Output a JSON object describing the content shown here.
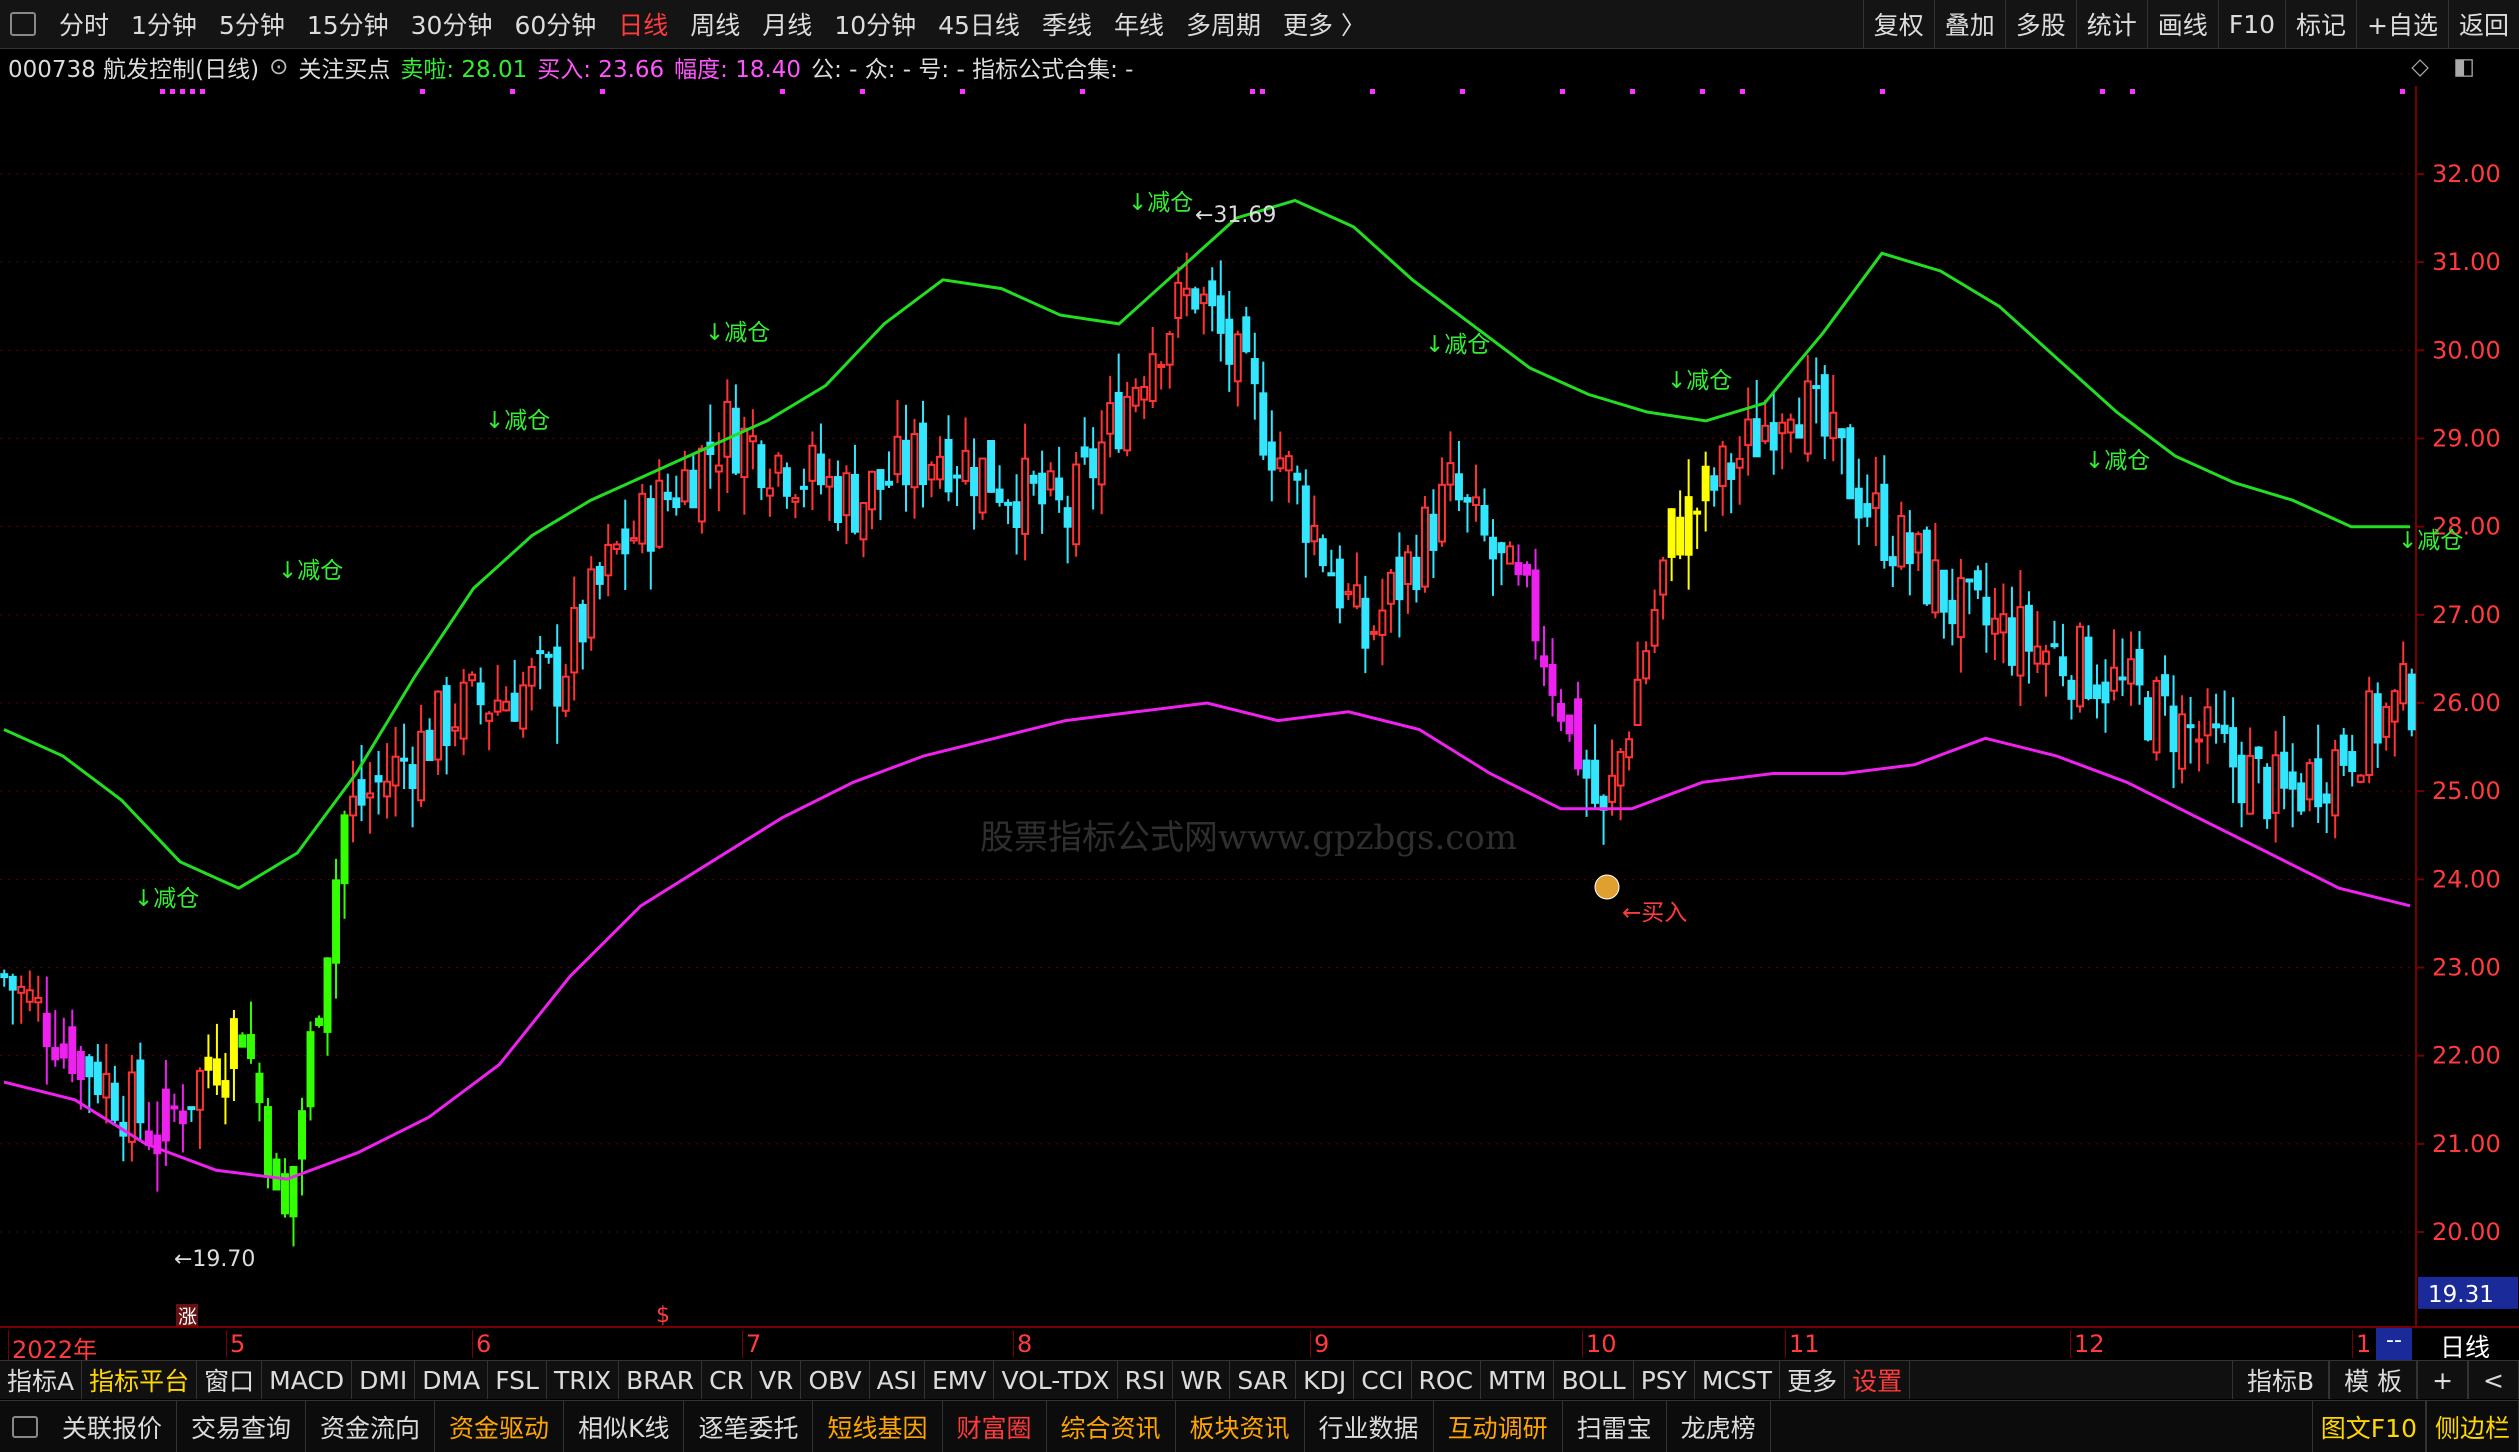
{
  "topbar": {
    "tabs": [
      "分时",
      "1分钟",
      "5分钟",
      "15分钟",
      "30分钟",
      "60分钟",
      "日线",
      "周线",
      "月线",
      "10分钟",
      "45日线",
      "季线",
      "年线",
      "多周期",
      "更多 〉"
    ],
    "active_tab": "日线",
    "right_buttons": [
      "复权",
      "叠加",
      "多股",
      "统计",
      "画线",
      "F10",
      "标记",
      "+自选",
      "返回"
    ]
  },
  "info": {
    "stock_title": "000738 航发控制(日线)",
    "indicator_name": "关注买点",
    "sell": "卖啦: 28.01",
    "buy": "买入: 23.66",
    "range": "幅度: 18.40",
    "extra": "公: -  众: -  号: -  指标公式合集: -"
  },
  "colors": {
    "up": "#ff3333",
    "down": "#33e6ff",
    "upper": "#22dd22",
    "lower": "#ee22ee",
    "yellow": "#ffff00",
    "green_bar": "#33ff00",
    "label_green": "#33ee33",
    "axis_red": "#ff3b3b"
  },
  "yaxis": {
    "ticks": [
      "32.00",
      "31.00",
      "30.00",
      "29.00",
      "28.00",
      "27.00",
      "26.00",
      "25.00",
      "24.00",
      "23.00",
      "22.00",
      "21.00",
      "20.00"
    ],
    "current_price": "19.31"
  },
  "xaxis": {
    "labels": [
      "2022年",
      "5",
      "6",
      "7",
      "8",
      "9",
      "10",
      "11",
      "12",
      "1"
    ],
    "period_label": "日线",
    "end_marker": "--"
  },
  "annotations": {
    "sell_label": "↓减仓",
    "buy_label": "←买入",
    "high_label": "←31.69",
    "low_label": "←19.70",
    "zhang_mark": "涨",
    "dollar_mark": "$",
    "watermark": "股票指标公式网www.gpzbgs.com"
  },
  "chart_data": {
    "type": "candlestick",
    "series_names": [],
    "price_range": [
      19.5,
      32.7
    ],
    "high": 31.69,
    "low": 19.7,
    "current": 19.31,
    "upper_band": [
      25.7,
      25.4,
      24.9,
      24.2,
      23.9,
      24.3,
      25.2,
      26.3,
      27.3,
      27.9,
      28.3,
      28.6,
      28.9,
      29.2,
      29.6,
      30.3,
      30.8,
      30.7,
      30.4,
      30.3,
      30.9,
      31.5,
      31.7,
      31.4,
      30.8,
      30.3,
      29.8,
      29.5,
      29.3,
      29.2,
      29.4,
      30.2,
      31.1,
      30.9,
      30.5,
      29.9,
      29.3,
      28.8,
      28.5,
      28.3,
      28.0,
      28.0
    ],
    "lower_band": [
      21.7,
      21.5,
      21.0,
      20.7,
      20.6,
      20.9,
      21.3,
      21.9,
      22.9,
      23.7,
      24.2,
      24.7,
      25.1,
      25.4,
      25.6,
      25.8,
      25.9,
      26.0,
      25.8,
      25.9,
      25.7,
      25.2,
      24.8,
      24.8,
      25.1,
      25.2,
      25.2,
      25.3,
      25.6,
      25.4,
      25.1,
      24.7,
      24.3,
      23.9,
      23.7
    ],
    "sell_signals": 8,
    "buy_signals": 1
  },
  "indbar": {
    "items": [
      "指标A",
      "指标平台",
      "窗口",
      "MACD",
      "DMI",
      "DMA",
      "FSL",
      "TRIX",
      "BRAR",
      "CR",
      "VR",
      "OBV",
      "ASI",
      "EMV",
      "VOL-TDX",
      "RSI",
      "WR",
      "SAR",
      "KDJ",
      "CCI",
      "ROC",
      "MTM",
      "BOLL",
      "PSY",
      "MCST",
      "更多",
      "设置"
    ],
    "highlight": "指标平台",
    "settings": "设置",
    "right_items": [
      "指标B",
      "模 板",
      "+",
      "<"
    ]
  },
  "funcbar": {
    "items": [
      {
        "label": "关联报价",
        "color": "#dcdcdc"
      },
      {
        "label": "交易查询",
        "color": "#dcdcdc"
      },
      {
        "label": "资金流向",
        "color": "#dcdcdc"
      },
      {
        "label": "资金驱动",
        "color": "#ffa500"
      },
      {
        "label": "相似K线",
        "color": "#dcdcdc"
      },
      {
        "label": "逐笔委托",
        "color": "#dcdcdc"
      },
      {
        "label": "短线基因",
        "color": "#ffa500"
      },
      {
        "label": "财富圈",
        "color": "#ff3b3b"
      },
      {
        "label": "综合资讯",
        "color": "#ffa500"
      },
      {
        "label": "板块资讯",
        "color": "#ffa500"
      },
      {
        "label": "行业数据",
        "color": "#dcdcdc"
      },
      {
        "label": "互动调研",
        "color": "#ffa500"
      },
      {
        "label": "扫雷宝",
        "color": "#dcdcdc"
      },
      {
        "label": "龙虎榜",
        "color": "#dcdcdc"
      }
    ],
    "right_items": [
      {
        "label": "图文F10",
        "color": "#ffd700"
      },
      {
        "label": "侧边栏",
        "color": "#ffd700"
      }
    ]
  }
}
